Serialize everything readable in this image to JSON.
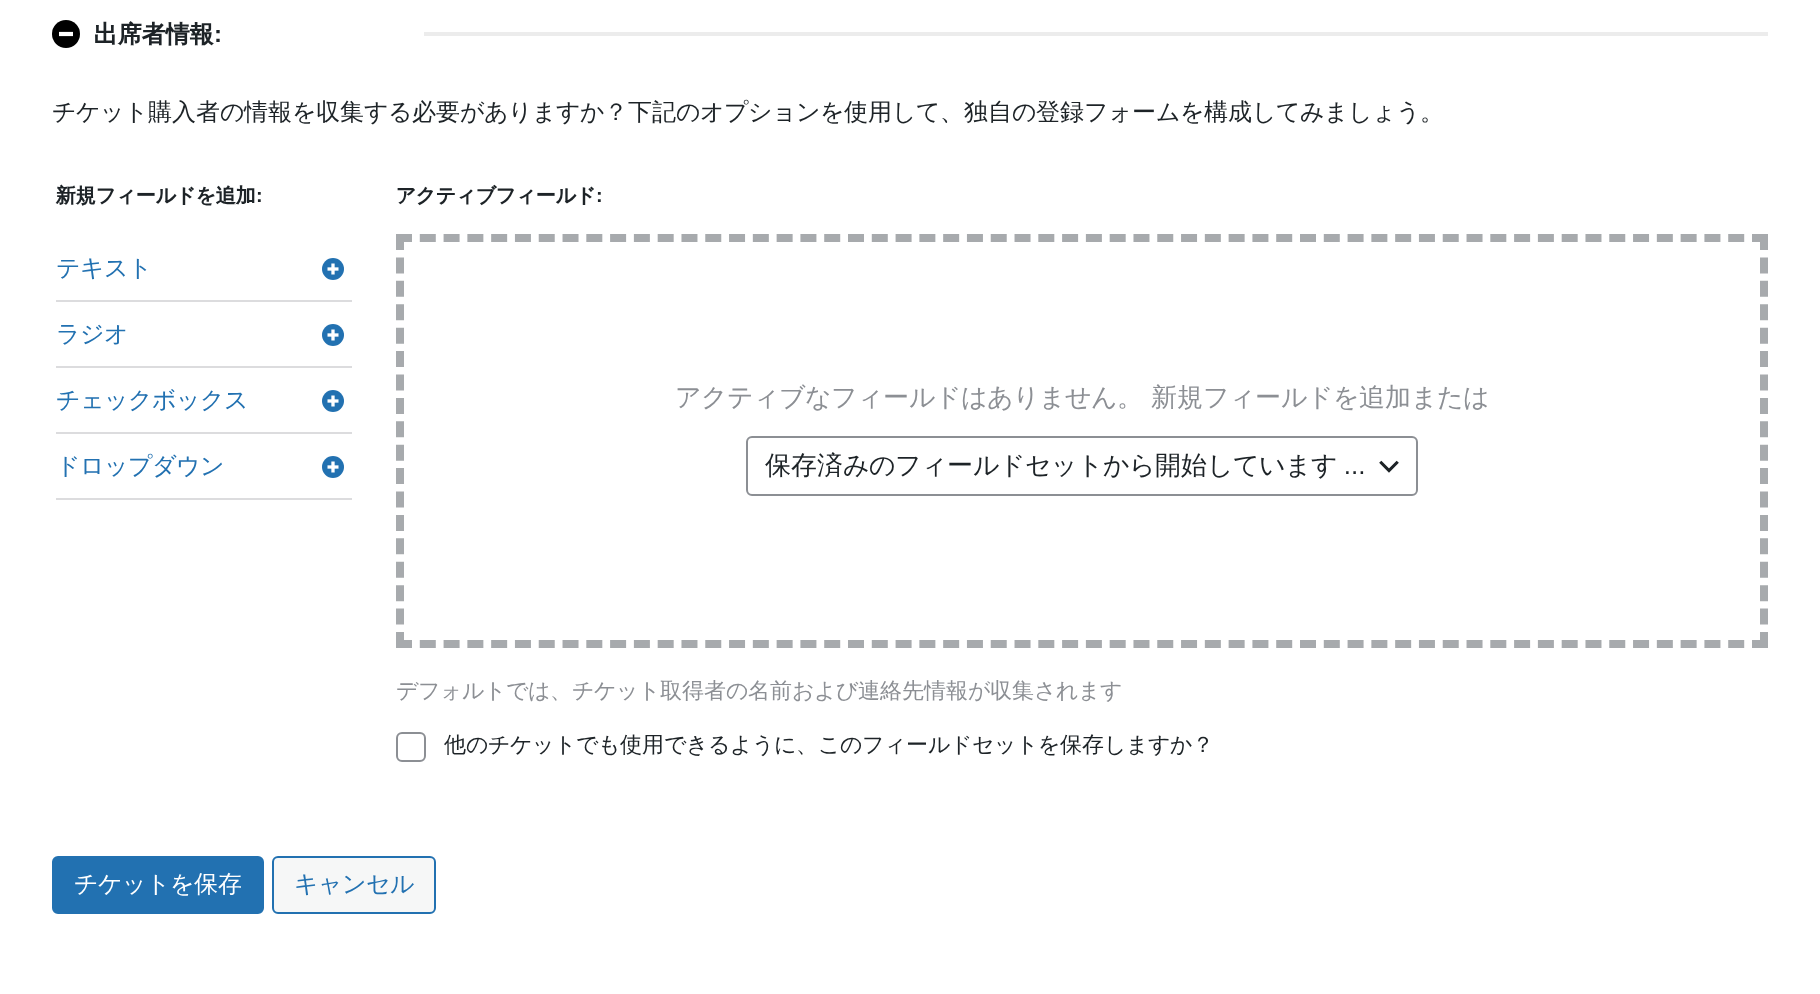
{
  "section": {
    "title": "出席者情報:",
    "expanded": true
  },
  "description": "チケット購入者の情報を収集する必要がありますか？下記のオプションを使用して、独自の登録フォームを構成してみましょう。",
  "add_fields": {
    "heading": "新規フィールドを追加:",
    "items": [
      {
        "label": "テキスト"
      },
      {
        "label": "ラジオ"
      },
      {
        "label": "チェックボックス"
      },
      {
        "label": "ドロップダウン"
      }
    ]
  },
  "active_fields": {
    "heading": "アクティブフィールド:",
    "empty_message": "アクティブなフィールドはありません。 新規フィールドを追加または",
    "fieldset_select": {
      "value": "保存済みのフィールドセットから開始しています ..."
    }
  },
  "help_text": "デフォルトでは、チケット取得者の名前および連絡先情報が収集されます",
  "save_fieldset": {
    "label": "他のチケットでも使用できるように、このフィールドセットを保存しますか？",
    "checked": false
  },
  "buttons": [
    {
      "label": "チケットを保存",
      "kind": "primary"
    },
    {
      "label": "キャンセル",
      "kind": "secondary"
    }
  ]
}
